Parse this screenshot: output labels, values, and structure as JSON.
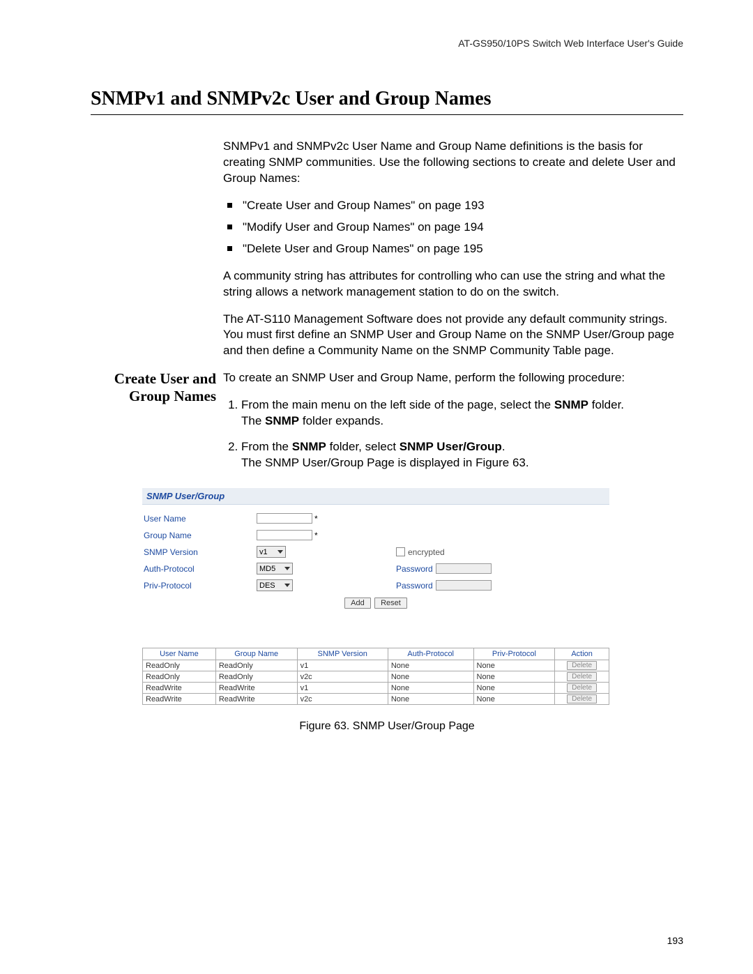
{
  "header": "AT-GS950/10PS Switch Web Interface User's Guide",
  "section_title": "SNMPv1 and SNMPv2c User and Group Names",
  "intro_para": "SNMPv1 and SNMPv2c User Name and Group Name definitions is the basis for creating SNMP communities. Use the following sections to create and delete User and Group Names:",
  "topic_list": [
    "\"Create User and Group Names\" on page 193",
    "\"Modify User and Group Names\" on page 194",
    "\"Delete User and Group Names\" on page 195"
  ],
  "para2": "A community string has attributes for controlling who can use the string and what the string allows a network management station to do on the switch.",
  "para3": "The AT-S110 Management Software does not provide any default community strings. You must first define an SNMP User and Group Name on the SNMP User/Group page and then define a Community Name on the SNMP Community Table page.",
  "subheading": "Create User and Group Names",
  "sub_intro": "To create an SNMP User and Group Name, perform the following procedure:",
  "step1_a": "From the main menu on the left side of the page, select the ",
  "step1_bold1": "SNMP",
  "step1_b": " folder.",
  "step1_c": "The ",
  "step1_bold2": "SNMP",
  "step1_d": " folder expands.",
  "step2_a": "From the ",
  "step2_bold1": "SNMP",
  "step2_b": " folder, select ",
  "step2_bold2": "SNMP User/Group",
  "step2_c": ".",
  "step2_d": "The SNMP User/Group Page is displayed in Figure 63.",
  "panel": {
    "title": "SNMP User/Group",
    "labels": {
      "user_name": "User Name",
      "group_name": "Group Name",
      "snmp_version": "SNMP Version",
      "auth_protocol": "Auth-Protocol",
      "priv_protocol": "Priv-Protocol",
      "encrypted": "encrypted",
      "password": "Password"
    },
    "selects": {
      "version": "v1",
      "auth": "MD5",
      "priv": "DES"
    },
    "buttons": {
      "add": "Add",
      "reset": "Reset",
      "delete": "Delete"
    }
  },
  "table": {
    "headers": [
      "User Name",
      "Group Name",
      "SNMP Version",
      "Auth-Protocol",
      "Priv-Protocol",
      "Action"
    ],
    "rows": [
      [
        "ReadOnly",
        "ReadOnly",
        "v1",
        "None",
        "None"
      ],
      [
        "ReadOnly",
        "ReadOnly",
        "v2c",
        "None",
        "None"
      ],
      [
        "ReadWrite",
        "ReadWrite",
        "v1",
        "None",
        "None"
      ],
      [
        "ReadWrite",
        "ReadWrite",
        "v2c",
        "None",
        "None"
      ]
    ]
  },
  "figure_caption": "Figure 63. SNMP User/Group Page",
  "page_number": "193"
}
